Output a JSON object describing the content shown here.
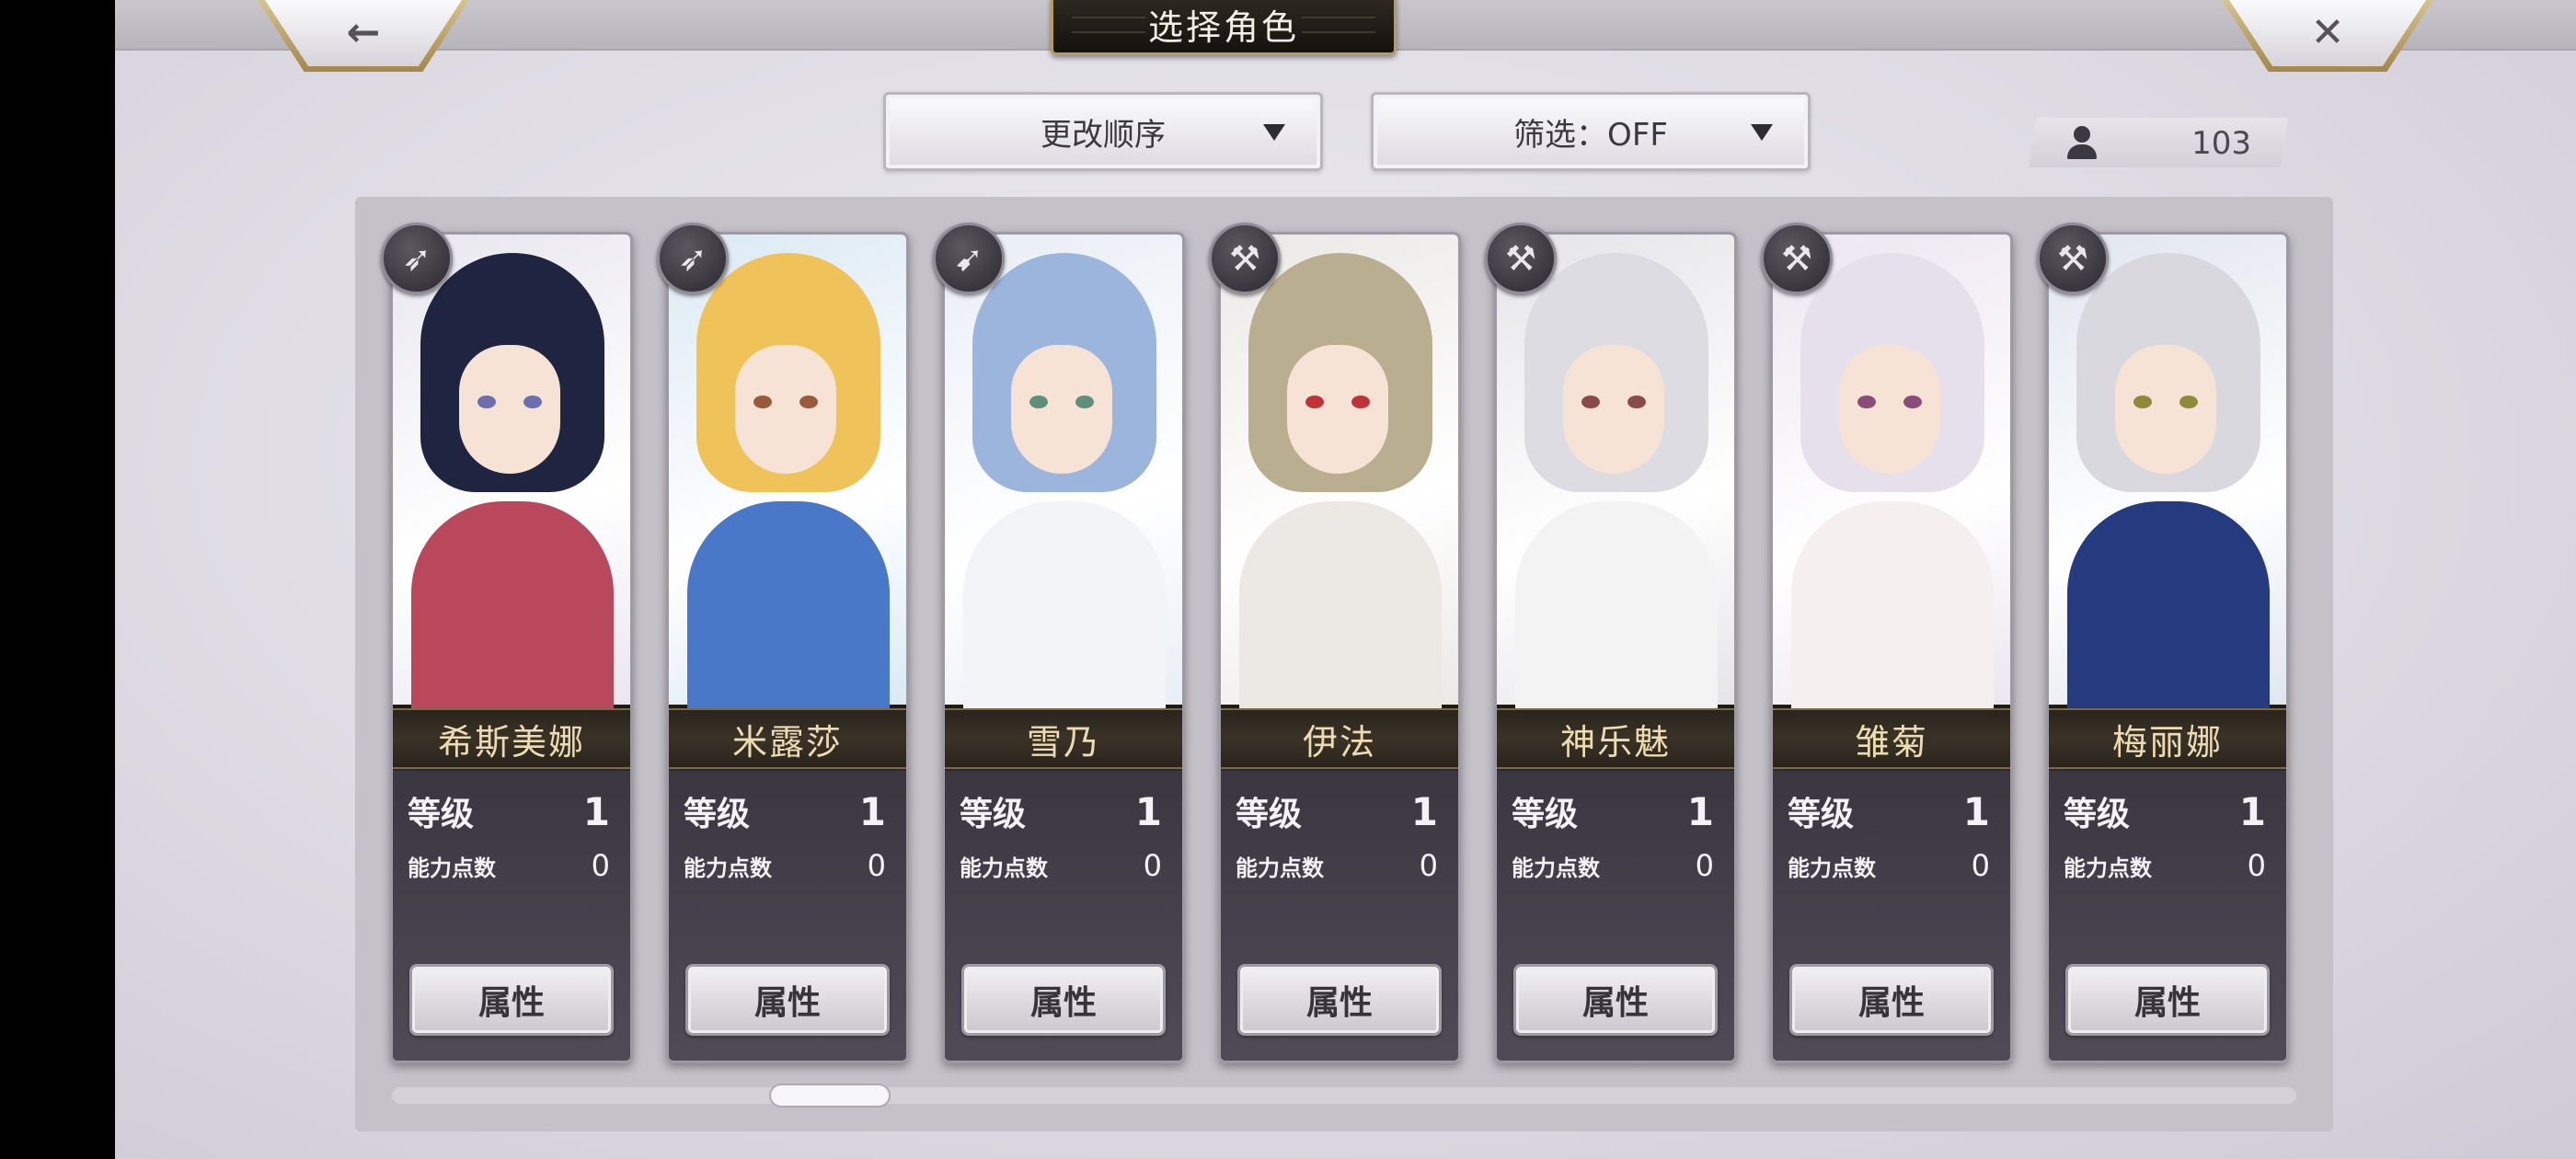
{
  "header": {
    "title": "选择角色",
    "back_icon": "←",
    "close_icon": "✕"
  },
  "controls": {
    "sort_label": "更改顺序",
    "filter_label": "筛选：OFF"
  },
  "counter": {
    "value": "103"
  },
  "labels": {
    "level": "等级",
    "ability_points": "能力点数",
    "attributes_button": "属性"
  },
  "characters": [
    {
      "name": "希斯美娜",
      "level": "1",
      "points": "0",
      "class_icon": "spear-icon",
      "hair": "#1f2440",
      "outfit": "#b9485c",
      "eye": "#6b6fb0",
      "bg": "#e9e7ef"
    },
    {
      "name": "米露莎",
      "level": "1",
      "points": "0",
      "class_icon": "spear-icon",
      "hair": "#f0c35a",
      "outfit": "#4a78c8",
      "eye": "#9a5a3a",
      "bg": "#dbe9f4"
    },
    {
      "name": "雪乃",
      "level": "1",
      "points": "0",
      "class_icon": "bow-icon",
      "hair": "#9cb5dc",
      "outfit": "#f2f4f8",
      "eye": "#5f8f7a",
      "bg": "#e9eef5"
    },
    {
      "name": "伊法",
      "level": "1",
      "points": "0",
      "class_icon": "hammer-icon",
      "hair": "#b9ae8f",
      "outfit": "#ece9e4",
      "eye": "#c0323a",
      "bg": "#ebe9e6"
    },
    {
      "name": "神乐魅",
      "level": "1",
      "points": "0",
      "class_icon": "hammer-icon",
      "hair": "#dcdce2",
      "outfit": "#f3f3f4",
      "eye": "#8a4a4a",
      "bg": "#e5e4e8"
    },
    {
      "name": "雏菊",
      "level": "1",
      "points": "0",
      "class_icon": "hammer-icon",
      "hair": "#e6e0ec",
      "outfit": "#f6efef",
      "eye": "#8a4a7a",
      "bg": "#ece6f0"
    },
    {
      "name": "梅丽娜",
      "level": "1",
      "points": "0",
      "class_icon": "hammer-icon",
      "hair": "#d8d8de",
      "outfit": "#263a80",
      "eye": "#8f8a3a",
      "bg": "#e1e6ee"
    }
  ]
}
